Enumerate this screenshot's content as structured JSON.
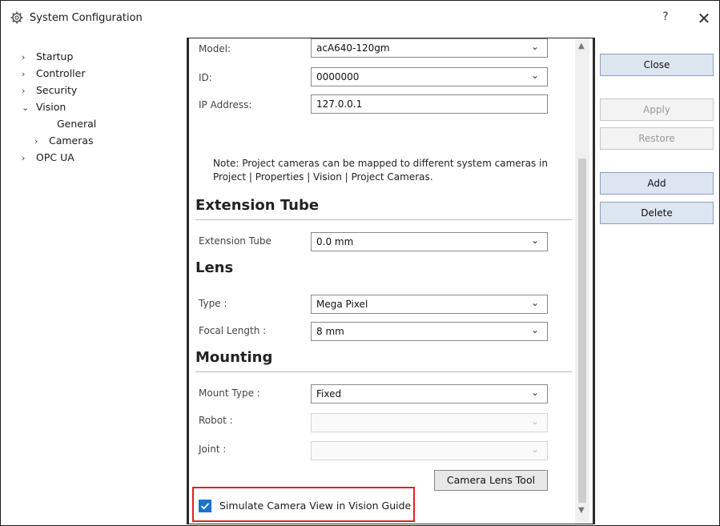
{
  "window": {
    "title": "System Configuration",
    "help_label": "?",
    "close_label": "✕"
  },
  "tree": {
    "items": [
      {
        "label": "Startup",
        "chevron": "›"
      },
      {
        "label": "Controller",
        "chevron": "›"
      },
      {
        "label": "Security",
        "chevron": "›"
      },
      {
        "label": "Vision",
        "chevron": "⌄"
      },
      {
        "label": "General",
        "chevron": ""
      },
      {
        "label": "Cameras",
        "chevron": "›"
      },
      {
        "label": "OPC UA",
        "chevron": "›"
      }
    ]
  },
  "camera": {
    "model_label": "Model:",
    "model_value": "acA640-120gm",
    "id_label": "ID:",
    "id_value": "0000000",
    "ip_label": "IP Address:",
    "ip_value": "127.0.0.1",
    "note_line1": "Note: Project cameras can be mapped to different system cameras in",
    "note_line2": "Project | Properties | Vision | Project Cameras."
  },
  "extension_tube": {
    "heading": "Extension Tube",
    "label": "Extension Tube",
    "value": "0.0 mm"
  },
  "lens": {
    "heading": "Lens",
    "type_label": "Type :",
    "type_value": "Mega Pixel",
    "focal_label": "Focal Length :",
    "focal_value": "8 mm"
  },
  "mounting": {
    "heading": "Mounting",
    "mount_type_label": "Mount Type :",
    "mount_type_value": "Fixed",
    "robot_label": "Robot :",
    "robot_value": "",
    "joint_label": "Joint :",
    "joint_value": ""
  },
  "camera_lens_tool_label": "Camera Lens Tool",
  "simulate": {
    "label": "Simulate Camera View in Vision Guide",
    "checked": true
  },
  "buttons": {
    "close": "Close",
    "apply": "Apply",
    "restore": "Restore",
    "add": "Add",
    "delete": "Delete"
  },
  "icons": {
    "title": "gear-icon",
    "chevron": "chevron-down-icon",
    "check": "checkmark-icon"
  },
  "colors": {
    "highlight": "#e02020",
    "checkbox": "#1a73d2",
    "button_bg": "#dde5f0"
  }
}
